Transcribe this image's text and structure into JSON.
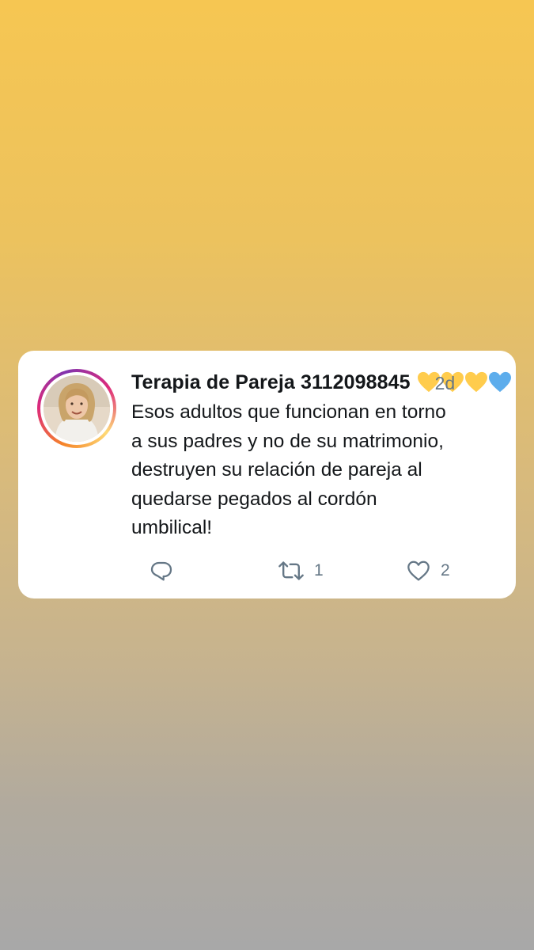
{
  "tweet": {
    "author_name": "Terapia de Pareja 3112098845",
    "timestamp": "2d",
    "text": "Esos adultos que funcionan en torno\na sus padres y no de su matrimonio,\ndestruyen su relación de pareja al\nquedarse pegados al cordón\numbilical!",
    "name_emojis": [
      "yellow-heart",
      "yellow-heart",
      "yellow-heart",
      "blue-heart"
    ]
  },
  "actions": {
    "reply_icon": "reply-icon",
    "retweet_icon": "retweet-icon",
    "retweet_count": "1",
    "like_icon": "heart-icon",
    "like_count": "2"
  },
  "colors": {
    "gradient_top": "#f6c652",
    "gradient_bottom": "#a8a8a8",
    "card_background": "#ffffff",
    "text_primary": "#14171a",
    "text_secondary": "#657786",
    "heart_yellow": "#ffcc4d",
    "heart_blue": "#5dadec"
  }
}
